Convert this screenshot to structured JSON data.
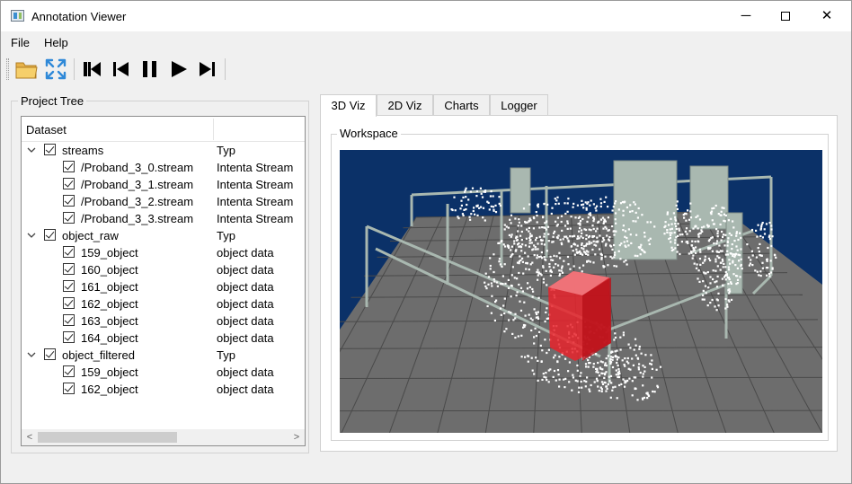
{
  "window": {
    "title": "Annotation Viewer",
    "controls": {
      "minimize": "─",
      "close": "✕"
    }
  },
  "menu": {
    "items": [
      "File",
      "Help"
    ]
  },
  "toolbar": {
    "buttons": [
      "folder-open-icon",
      "fit-view-icon",
      "skip-to-start-icon",
      "step-back-icon",
      "pause-icon",
      "play-icon",
      "step-forward-icon"
    ]
  },
  "project_tree": {
    "title": "Project Tree",
    "columns": [
      "Dataset",
      ""
    ],
    "groups": [
      {
        "name": "streams",
        "type": "Typ",
        "children": [
          {
            "name": "/Proband_3_0.stream",
            "type": "Intenta Stream"
          },
          {
            "name": "/Proband_3_1.stream",
            "type": "Intenta Stream"
          },
          {
            "name": "/Proband_3_2.stream",
            "type": "Intenta Stream"
          },
          {
            "name": "/Proband_3_3.stream",
            "type": "Intenta Stream"
          }
        ]
      },
      {
        "name": "object_raw",
        "type": "Typ",
        "children": [
          {
            "name": "159_object",
            "type": "object data"
          },
          {
            "name": "160_object",
            "type": "object data"
          },
          {
            "name": "161_object",
            "type": "object data"
          },
          {
            "name": "162_object",
            "type": "object data"
          },
          {
            "name": "163_object",
            "type": "object data"
          },
          {
            "name": "164_object",
            "type": "object data"
          }
        ]
      },
      {
        "name": "object_filtered",
        "type": "Typ",
        "children": [
          {
            "name": "159_object",
            "type": "object data"
          },
          {
            "name": "162_object",
            "type": "object data"
          }
        ]
      }
    ],
    "scroll_left": "<",
    "scroll_right": ">"
  },
  "tabs": [
    {
      "label": "3D Viz",
      "active": true
    },
    {
      "label": "2D Viz",
      "active": false
    },
    {
      "label": "Charts",
      "active": false
    },
    {
      "label": "Logger",
      "active": false
    }
  ],
  "workspace": {
    "label": "Workspace"
  },
  "colors": {
    "viz_background": "#0b3168",
    "floor": "#6d6d6d",
    "grid": "#4a4a4a",
    "frame": "#a9b8b0",
    "highlight": "#e8232c"
  }
}
